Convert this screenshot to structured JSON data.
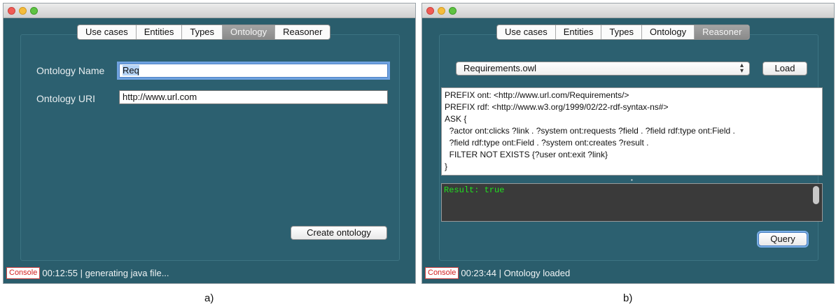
{
  "tabs": [
    "Use cases",
    "Entities",
    "Types",
    "Ontology",
    "Reasoner"
  ],
  "window_a": {
    "active_tab": "Ontology",
    "ontology_name_label": "Ontology Name",
    "ontology_name_value": "Req",
    "ontology_uri_label": "Ontology URI",
    "ontology_uri_value": "http://www.url.com",
    "create_button": "Create ontology",
    "console_label": "Console",
    "status_text": "00:12:55 | generating java file..."
  },
  "window_b": {
    "active_tab": "Reasoner",
    "file_select": "Requirements.owl",
    "load_button": "Load",
    "query_lines": [
      "PREFIX ont: <http://www.url.com/Requirements/>",
      "PREFIX rdf: <http://www.w3.org/1999/02/22-rdf-syntax-ns#>",
      "ASK {",
      "  ?actor ont:clicks ?link . ?system ont:requests ?field . ?field rdf:type ont:Field .",
      "  ?field rdf:type ont:Field . ?system ont:creates ?result .",
      "  FILTER NOT EXISTS {?user ont:exit ?link}",
      "}"
    ],
    "result_text": "Result: true",
    "query_button": "Query",
    "console_label": "Console",
    "status_text": "00:23:44 | Ontology loaded"
  },
  "captions": {
    "a": "a)",
    "b": "b)"
  }
}
